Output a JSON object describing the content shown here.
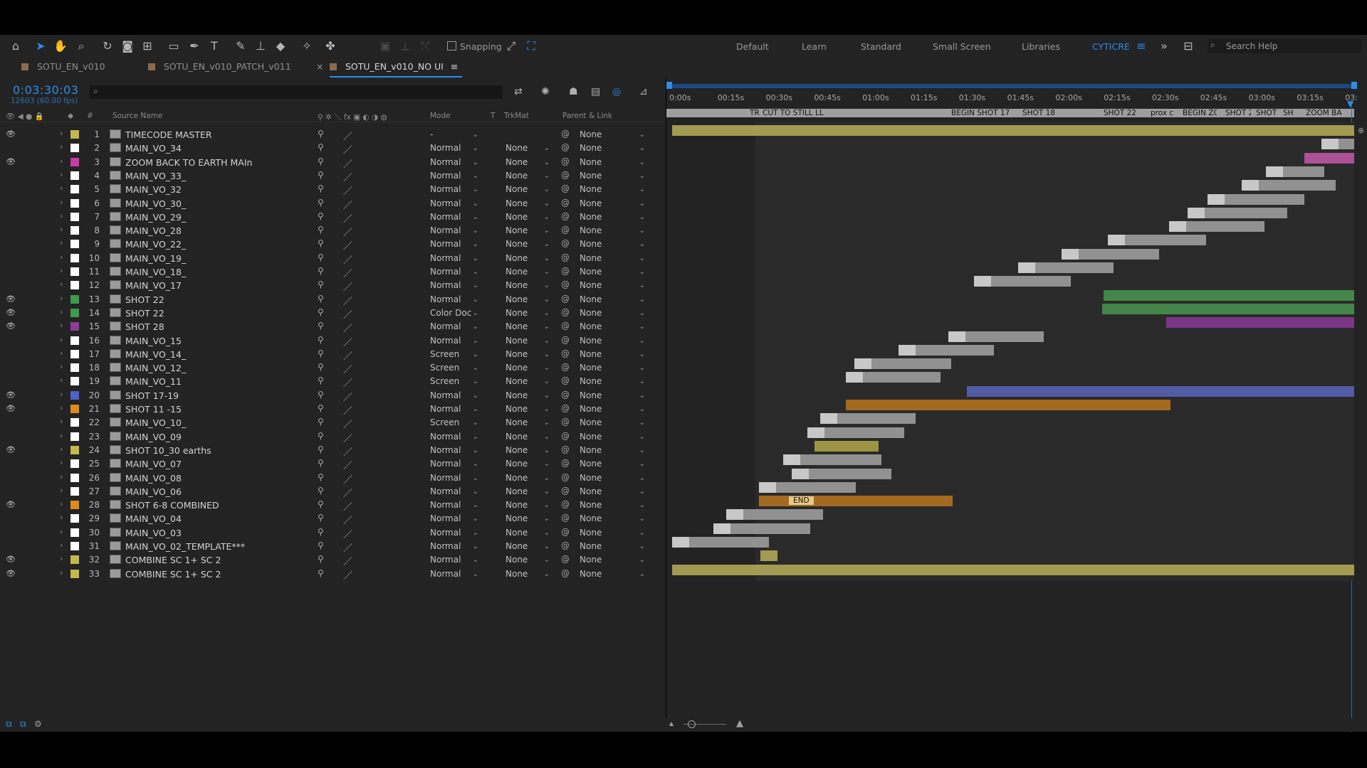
{
  "toolbar": {
    "tools": [
      "home-icon",
      "selection-tool-icon",
      "hand-tool-icon",
      "zoom-tool-icon",
      "rotate-tool-icon",
      "camera-tool-icon",
      "pan-behind-tool-icon",
      "rectangle-tool-icon",
      "pen-tool-icon",
      "type-tool-icon",
      "brush-tool-icon",
      "clone-stamp-tool-icon",
      "eraser-tool-icon",
      "roto-brush-tool-icon",
      "puppet-pin-tool-icon"
    ],
    "snapping_label": "Snapping",
    "workspaces": [
      "Default",
      "Learn",
      "Standard",
      "Small Screen",
      "Libraries",
      "CYTICRE"
    ],
    "active_workspace": "CYTICRE",
    "search_placeholder": "Search Help"
  },
  "tabs": [
    {
      "label": "SOTU_EN_v010",
      "active": false
    },
    {
      "label": "SOTU_EN_v010_PATCH_v011",
      "active": false
    },
    {
      "label": "SOTU_EN_v010_NO UI",
      "active": true
    }
  ],
  "timecode": "0:03:30:03",
  "fps_info": "12603 (60.00 fps)",
  "columns": {
    "source_name": "Source Name",
    "num": "#",
    "mode": "Mode",
    "t": "T",
    "trkmat": "TrkMat",
    "parent": "Parent & Link"
  },
  "time_ticks": [
    "0:00s",
    "00:15s",
    "00:30s",
    "00:45s",
    "01:00s",
    "01:15s",
    "01:30s",
    "01:45s",
    "02:00s",
    "02:15s",
    "02:30s",
    "02:45s",
    "03:00s",
    "03:15s",
    "03:"
  ],
  "markers": [
    "TR",
    "CUT TO STILL LL",
    "BEGIN SHOT 17",
    "SHOT 18",
    "SHOT 22",
    "prox ca",
    "BEGIN ZO",
    "SHOT 2",
    "SHOT",
    "SH",
    "ZOOM BA"
  ],
  "end_marker": "END",
  "colors": {
    "accent": "#2d8ceb",
    "yellow": "#c2b84c",
    "white": "#ffffff",
    "green": "#3d9b4e",
    "magenta": "#c83aa5",
    "purple": "#8e3a9c",
    "blue": "#5060c8",
    "orange": "#e08a1a"
  },
  "layers": [
    {
      "num": "1",
      "name": "TIMECODE MASTER",
      "mode": "-",
      "trk": "",
      "parent": "None",
      "label": "#c2b84c",
      "eye": true
    },
    {
      "num": "2",
      "name": "MAIN_VO_34",
      "mode": "Normal",
      "trk": "None",
      "parent": "None",
      "label": "#ffffff",
      "eye": false
    },
    {
      "num": "3",
      "name": "ZOOM BACK TO EARTH MAIn",
      "mode": "Normal",
      "trk": "None",
      "parent": "None",
      "label": "#c83aa5",
      "eye": true
    },
    {
      "num": "4",
      "name": "MAIN_VO_33_",
      "mode": "Normal",
      "trk": "None",
      "parent": "None",
      "label": "#ffffff",
      "eye": false
    },
    {
      "num": "5",
      "name": "MAIN_VO_32",
      "mode": "Normal",
      "trk": "None",
      "parent": "None",
      "label": "#ffffff",
      "eye": false
    },
    {
      "num": "6",
      "name": "MAIN_VO_30_",
      "mode": "Normal",
      "trk": "None",
      "parent": "None",
      "label": "#ffffff",
      "eye": false
    },
    {
      "num": "7",
      "name": "MAIN_VO_29_",
      "mode": "Normal",
      "trk": "None",
      "parent": "None",
      "label": "#ffffff",
      "eye": false
    },
    {
      "num": "8",
      "name": "MAIN_VO_28",
      "mode": "Normal",
      "trk": "None",
      "parent": "None",
      "label": "#ffffff",
      "eye": false
    },
    {
      "num": "9",
      "name": "MAIN_VO_22_",
      "mode": "Normal",
      "trk": "None",
      "parent": "None",
      "label": "#ffffff",
      "eye": false
    },
    {
      "num": "10",
      "name": "MAIN_VO_19_",
      "mode": "Normal",
      "trk": "None",
      "parent": "None",
      "label": "#ffffff",
      "eye": false
    },
    {
      "num": "11",
      "name": "MAIN_VO_18_",
      "mode": "Normal",
      "trk": "None",
      "parent": "None",
      "label": "#ffffff",
      "eye": false
    },
    {
      "num": "12",
      "name": "MAIN_VO_17",
      "mode": "Normal",
      "trk": "None",
      "parent": "None",
      "label": "#ffffff",
      "eye": false
    },
    {
      "num": "13",
      "name": "SHOT 22",
      "mode": "Normal",
      "trk": "None",
      "parent": "None",
      "label": "#3d9b4e",
      "eye": true
    },
    {
      "num": "14",
      "name": "SHOT 22",
      "mode": "Color Doc",
      "trk": "None",
      "parent": "None",
      "label": "#3d9b4e",
      "eye": true
    },
    {
      "num": "15",
      "name": "SHOT 28",
      "mode": "Normal",
      "trk": "None",
      "parent": "None",
      "label": "#8e3a9c",
      "eye": true
    },
    {
      "num": "16",
      "name": "MAIN_VO_15",
      "mode": "Normal",
      "trk": "None",
      "parent": "None",
      "label": "#ffffff",
      "eye": false
    },
    {
      "num": "17",
      "name": "MAIN_VO_14_",
      "mode": "Screen",
      "trk": "None",
      "parent": "None",
      "label": "#ffffff",
      "eye": false
    },
    {
      "num": "18",
      "name": "MAIN_VO_12_",
      "mode": "Screen",
      "trk": "None",
      "parent": "None",
      "label": "#ffffff",
      "eye": false
    },
    {
      "num": "19",
      "name": "MAIN_VO_11",
      "mode": "Screen",
      "trk": "None",
      "parent": "None",
      "label": "#ffffff",
      "eye": false
    },
    {
      "num": "20",
      "name": "SHOT 17-19",
      "mode": "Normal",
      "trk": "None",
      "parent": "None",
      "label": "#5060c8",
      "eye": true
    },
    {
      "num": "21",
      "name": "SHOT 11 -15",
      "mode": "Normal",
      "trk": "None",
      "parent": "None",
      "label": "#e08a1a",
      "eye": true
    },
    {
      "num": "22",
      "name": "MAIN_VO_10_",
      "mode": "Screen",
      "trk": "None",
      "parent": "None",
      "label": "#ffffff",
      "eye": false
    },
    {
      "num": "23",
      "name": "MAIN_VO_09",
      "mode": "Normal",
      "trk": "None",
      "parent": "None",
      "label": "#ffffff",
      "eye": false
    },
    {
      "num": "24",
      "name": "SHOT 10_30 earths",
      "mode": "Normal",
      "trk": "None",
      "parent": "None",
      "label": "#c2b84c",
      "eye": true
    },
    {
      "num": "25",
      "name": "MAIN_VO_07",
      "mode": "Normal",
      "trk": "None",
      "parent": "None",
      "label": "#ffffff",
      "eye": false
    },
    {
      "num": "26",
      "name": "MAIN_VO_08",
      "mode": "Normal",
      "trk": "None",
      "parent": "None",
      "label": "#ffffff",
      "eye": false
    },
    {
      "num": "27",
      "name": "MAIN_VO_06",
      "mode": "Normal",
      "trk": "None",
      "parent": "None",
      "label": "#ffffff",
      "eye": false
    },
    {
      "num": "28",
      "name": "SHOT 6-8 COMBINED",
      "mode": "Normal",
      "trk": "None",
      "parent": "None",
      "label": "#e08a1a",
      "eye": true
    },
    {
      "num": "29",
      "name": "MAIN_VO_04",
      "mode": "Normal",
      "trk": "None",
      "parent": "None",
      "label": "#ffffff",
      "eye": false
    },
    {
      "num": "30",
      "name": "MAIN_VO_03",
      "mode": "Normal",
      "trk": "None",
      "parent": "None",
      "label": "#ffffff",
      "eye": false
    },
    {
      "num": "31",
      "name": "MAIN_VO_02_TEMPLATE***",
      "mode": "Normal",
      "trk": "None",
      "parent": "None",
      "label": "#ffffff",
      "eye": false
    },
    {
      "num": "32",
      "name": "COMBINE SC 1+ SC 2",
      "mode": "Normal",
      "trk": "None",
      "parent": "None",
      "label": "#c2b84c",
      "eye": true
    },
    {
      "num": "33",
      "name": "COMBINE SC 1+ SC 2",
      "mode": "Normal",
      "trk": "None",
      "parent": "None",
      "label": "#c2b84c",
      "eye": true
    }
  ]
}
